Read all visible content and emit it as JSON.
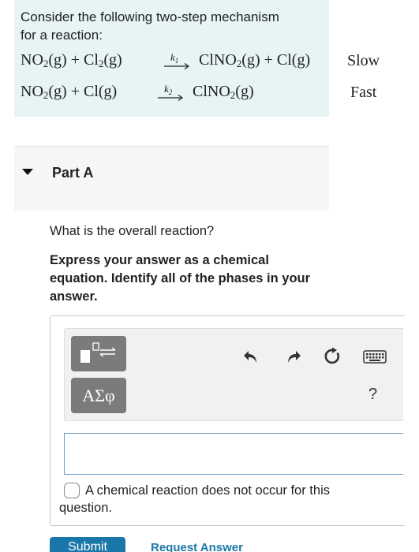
{
  "intro": {
    "line1": "Consider the following two-step mechanism",
    "line2": "for a reaction:"
  },
  "steps": [
    {
      "reactant_a": "NO",
      "reactant_a_sub": "2",
      "reactant_a_phase": "(g) + Cl",
      "reactant_b_sub": "2",
      "reactant_b_phase": "(g)",
      "rate_constant": "k",
      "rate_constant_sub": "1",
      "product_a": "ClNO",
      "product_a_sub": "2",
      "product_tail": "(g) + Cl(g)",
      "speed": "Slow"
    },
    {
      "reactant_a": "NO",
      "reactant_a_sub": "2",
      "reactant_a_phase": "(g) + Cl(g)",
      "rate_constant": "k",
      "rate_constant_sub": "2",
      "product_a": "ClNO",
      "product_a_sub": "2",
      "product_tail": "(g)",
      "speed": "Fast"
    }
  ],
  "part": {
    "title": "Part A"
  },
  "question": "What is the overall reaction?",
  "instructions": "Express your answer as a chemical equation. Identify all of the phases in your answer.",
  "toolbar": {
    "greek_label": "ΑΣφ",
    "help_label": "?",
    "icons": [
      "template-icon",
      "undo-icon",
      "redo-icon",
      "reset-icon",
      "keyboard-icon",
      "help-icon"
    ]
  },
  "answer": {
    "value": "",
    "no_reaction_label": "A chemical reaction does not occur for this question."
  },
  "actions": {
    "submit_label": "Submit",
    "request_label": "Request Answer"
  },
  "colors": {
    "intro_bg": "#e6f4f3",
    "button_gray": "#7b7b7b",
    "link_blue": "#1a77a9"
  }
}
